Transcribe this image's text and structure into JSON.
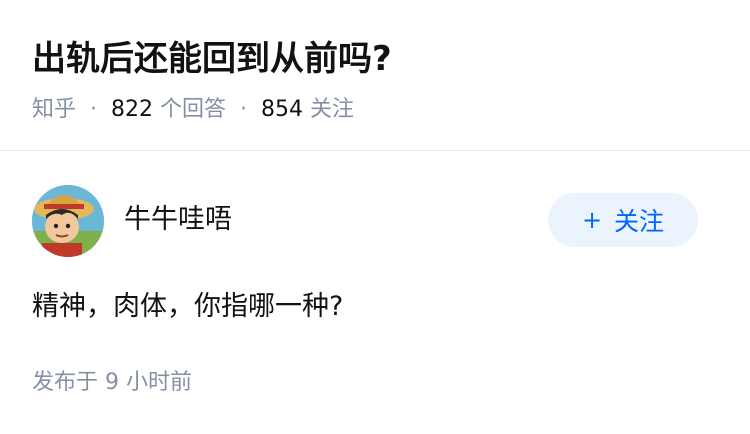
{
  "question": {
    "title": "出轨后还能回到从前吗?",
    "source": "知乎",
    "answer_count": "822",
    "answer_label": "个回答",
    "follow_count": "854",
    "follow_label": "关注"
  },
  "answer": {
    "author": "牛牛哇唔",
    "avatar_icon": "avatar-cartoon-boy-straw-hat",
    "follow_button": {
      "plus": "+",
      "label": "关注"
    },
    "content": "精神，肉体，你指哪一种?",
    "time_prefix": "发布于",
    "time_value": "9 小时前"
  },
  "colors": {
    "meta_gray": "#8590a6",
    "accent_blue": "#0066ff",
    "button_bg": "#ebf3fc",
    "text": "#121212"
  }
}
